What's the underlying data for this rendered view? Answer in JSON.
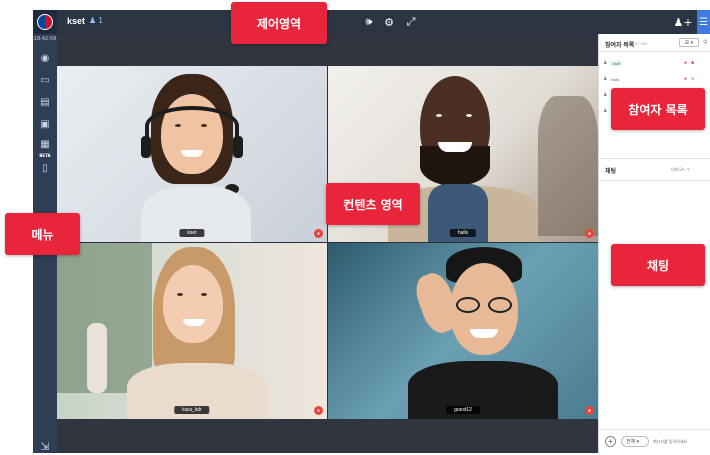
{
  "app": {
    "time": "18:42:59",
    "room_name": "kset",
    "user_count": "1"
  },
  "sidebar": {
    "items": [
      {
        "icon": "user-circle-icon"
      },
      {
        "icon": "monitor-icon"
      },
      {
        "icon": "clipboard-icon"
      },
      {
        "icon": "play-icon"
      },
      {
        "icon": "whiteboard-icon",
        "badge": "BETA"
      },
      {
        "icon": "person-card-icon"
      }
    ],
    "exit_icon": "exit-icon"
  },
  "topbar": {
    "center_icons": [
      "speaker-icon",
      "gear-icon",
      "fullscreen-icon"
    ],
    "right_icon": "add-user-icon",
    "menu_icon": "menu-icon"
  },
  "video_tiles": [
    {
      "name": "kset"
    },
    {
      "name": "halls"
    },
    {
      "name": "kara_kdr"
    },
    {
      "name": "guest12"
    }
  ],
  "participants_panel": {
    "title": "참여자 목록",
    "count": "4 / 200",
    "select_label": "☰ ▾",
    "rows": [
      {
        "tag": "kset",
        "name": ""
      },
      {
        "tag": "",
        "name": "halls"
      },
      {
        "tag": "",
        "name": ""
      },
      {
        "tag": "",
        "name": ""
      }
    ]
  },
  "chat_panel": {
    "title": "채팅",
    "hint": "대화모드 ✎",
    "target": "전체",
    "input_placeholder": "메시지를 입력하세요"
  },
  "callouts": {
    "control": "제어영역",
    "content": "컨텐츠 영역",
    "menu": "메뉴",
    "participants": "참여자 목록",
    "chat": "채팅"
  },
  "colors": {
    "sidebar": "#2f3d55",
    "topbar": "#2b3442",
    "callout": "#e8253b",
    "accent": "#3d7be0"
  }
}
